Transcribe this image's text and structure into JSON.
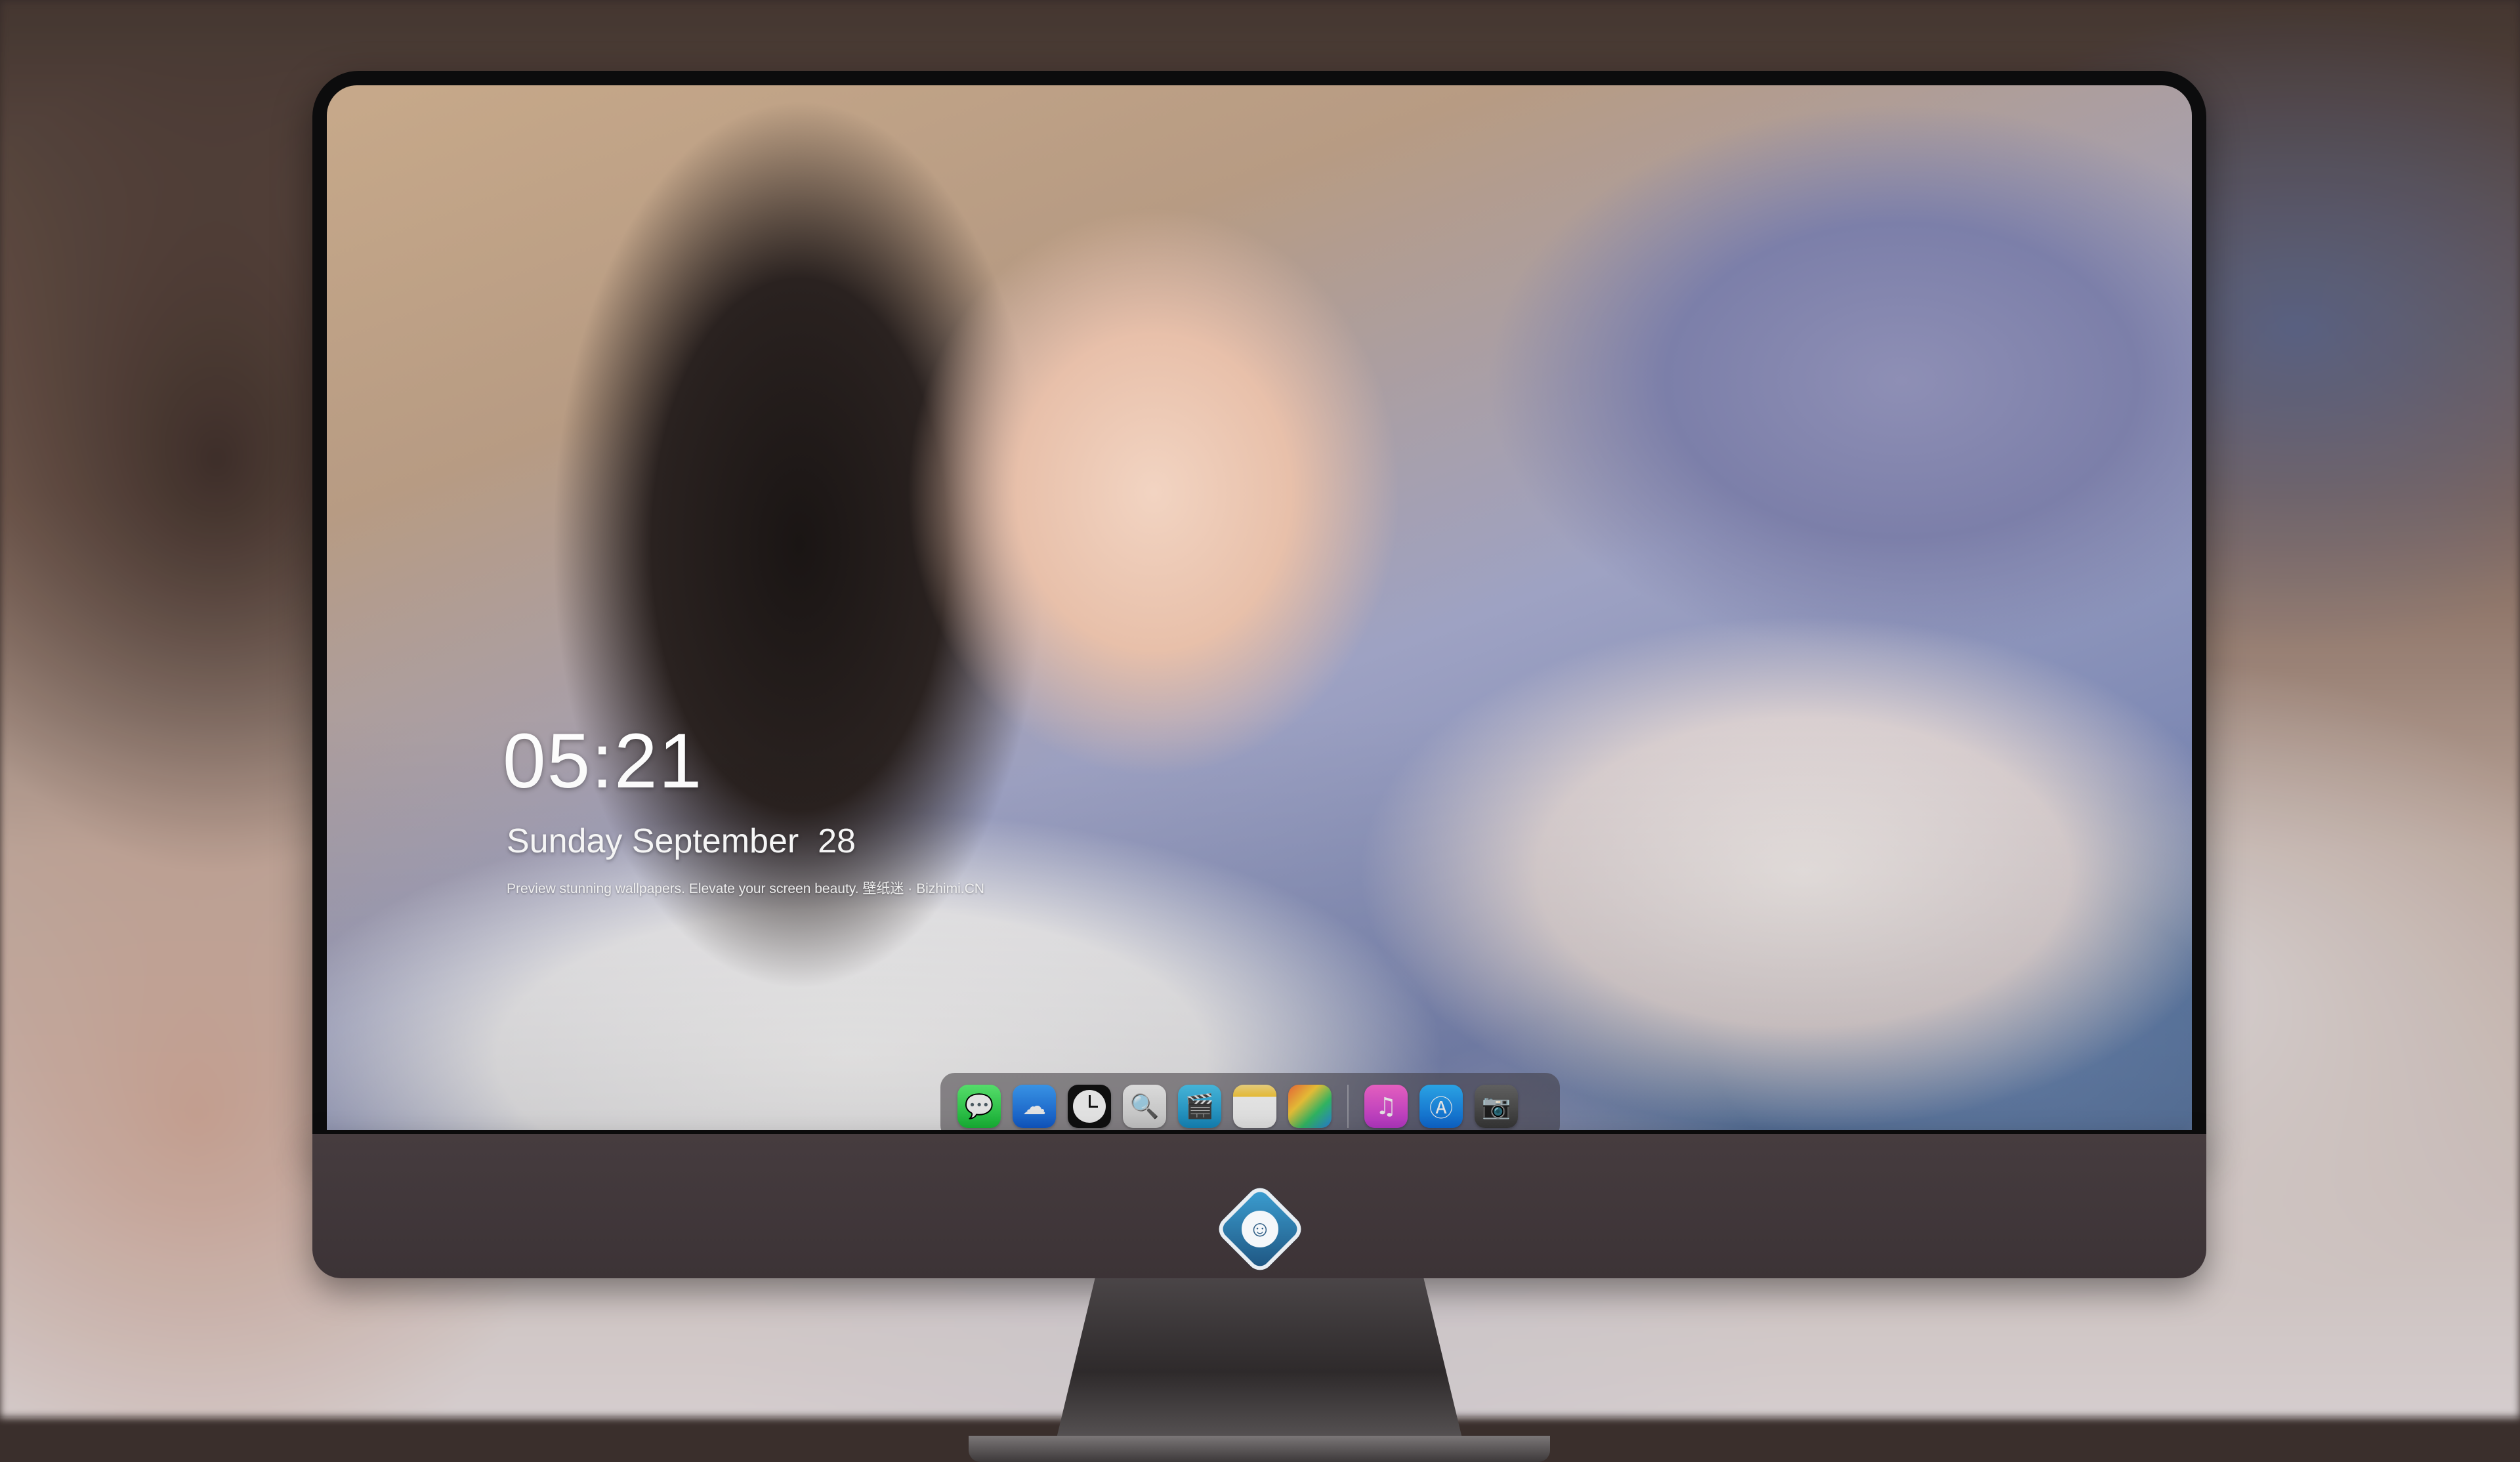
{
  "lock_screen": {
    "time": "05:21",
    "date": "Sunday September  28",
    "tagline": "Preview stunning wallpapers. Elevate your screen beauty. 壁纸迷 · Bizhimi.CN"
  },
  "dock": {
    "apps": [
      {
        "name": "messages-icon",
        "glyph": "💬"
      },
      {
        "name": "weather-icon",
        "glyph": "☁"
      },
      {
        "name": "clock-icon",
        "glyph": ""
      },
      {
        "name": "preview-icon",
        "glyph": "🔍"
      },
      {
        "name": "claquette-icon",
        "glyph": "🎬"
      },
      {
        "name": "notes-icon",
        "glyph": ""
      },
      {
        "name": "photo-booth-icon",
        "glyph": ""
      },
      {
        "name": "music-icon",
        "glyph": "♫"
      },
      {
        "name": "app-store-icon",
        "glyph": "Ⓐ"
      },
      {
        "name": "screenshot-icon",
        "glyph": "📷"
      }
    ]
  },
  "monitor": {
    "logo_icon": "mascot-logo-icon"
  },
  "colors": {
    "bezel": "#0c0c0d",
    "chin": "#463c3f",
    "dock_bg": "rgba(70,64,70,0.55)",
    "text": "#ffffff"
  }
}
